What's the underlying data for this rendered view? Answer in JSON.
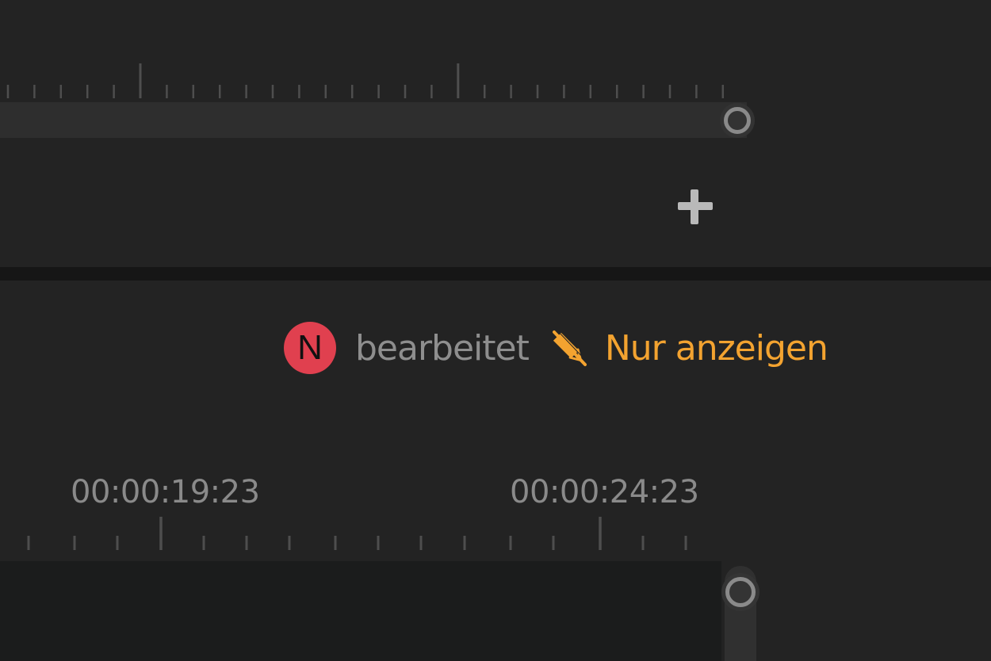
{
  "timeline_top": {
    "add_icon": "plus-icon",
    "handle_icon": "circle-handle-icon"
  },
  "collaboration": {
    "user_initial": "N",
    "user_color": "#e0404f",
    "status_text": "bearbeitet",
    "mode_icon": "pencil-crossed-icon",
    "mode_label": "Nur anzeigen",
    "mode_color": "#f3a330"
  },
  "timeline_bottom": {
    "timecodes": [
      "00:00:19:23",
      "00:00:24:23"
    ],
    "handle_icon": "circle-handle-icon"
  }
}
